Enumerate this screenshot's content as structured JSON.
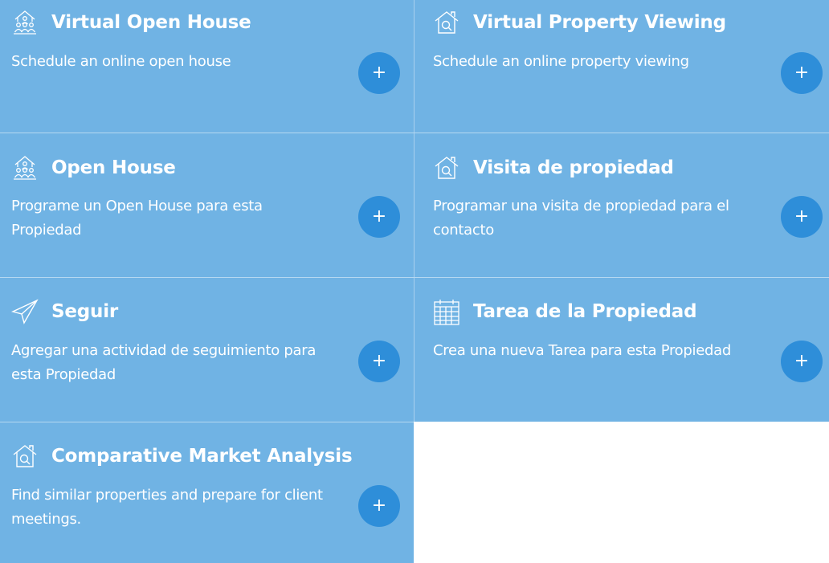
{
  "cards": [
    {
      "title": "Virtual Open House",
      "description_lines": [
        "Schedule an online open house"
      ],
      "icon": "open-house-people-icon",
      "action": "+"
    },
    {
      "title": "Virtual Property Viewing",
      "description_lines": [
        "Schedule an online property viewing"
      ],
      "icon": "house-search-icon",
      "action": "+"
    },
    {
      "title": "Open House",
      "description_lines": [
        "Programe un Open House para esta",
        "Propiedad"
      ],
      "icon": "open-house-people-icon",
      "action": "+"
    },
    {
      "title": "Visita de propiedad",
      "description_lines": [
        "Programar una visita de propiedad para el",
        "contacto"
      ],
      "icon": "house-search-icon",
      "action": "+"
    },
    {
      "title": "Seguir",
      "description_lines": [
        "Agregar una actividad de seguimiento para",
        "esta Propiedad"
      ],
      "icon": "paper-plane-icon",
      "action": "+"
    },
    {
      "title": "Tarea de la Propiedad",
      "description_lines": [
        "Crea una nueva Tarea para esta Propiedad"
      ],
      "icon": "calendar-icon",
      "action": "+"
    },
    {
      "title": "Comparative Market Analysis",
      "description_lines": [
        "Find similar properties and prepare for client",
        "meetings."
      ],
      "icon": "house-search-icon",
      "action": "+"
    }
  ],
  "colors": {
    "card_bg": "#70b3e4",
    "button_bg": "#2e8ed9",
    "text": "#ffffff",
    "page_bg": "#ffffff"
  }
}
